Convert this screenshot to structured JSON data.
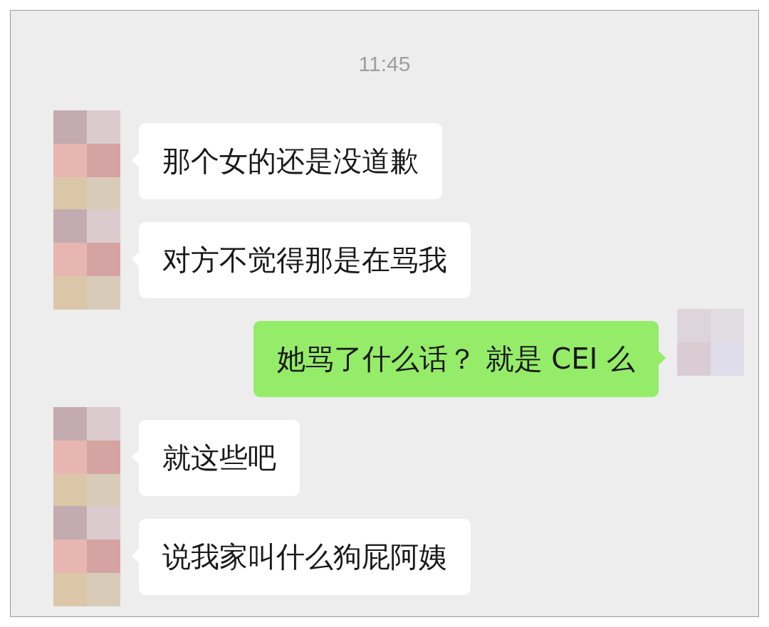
{
  "time": "11:45",
  "messages": [
    {
      "kind": "incoming",
      "text": "那个女的还是没道歉"
    },
    {
      "kind": "incoming",
      "text": "对方不觉得那是在骂我"
    },
    {
      "kind": "outgoing",
      "text": "她骂了什么话？ 就是 CEI 么"
    },
    {
      "kind": "incoming",
      "text": "就这些吧"
    },
    {
      "kind": "incoming",
      "text": "说我家叫什么狗屁阿姨"
    }
  ]
}
